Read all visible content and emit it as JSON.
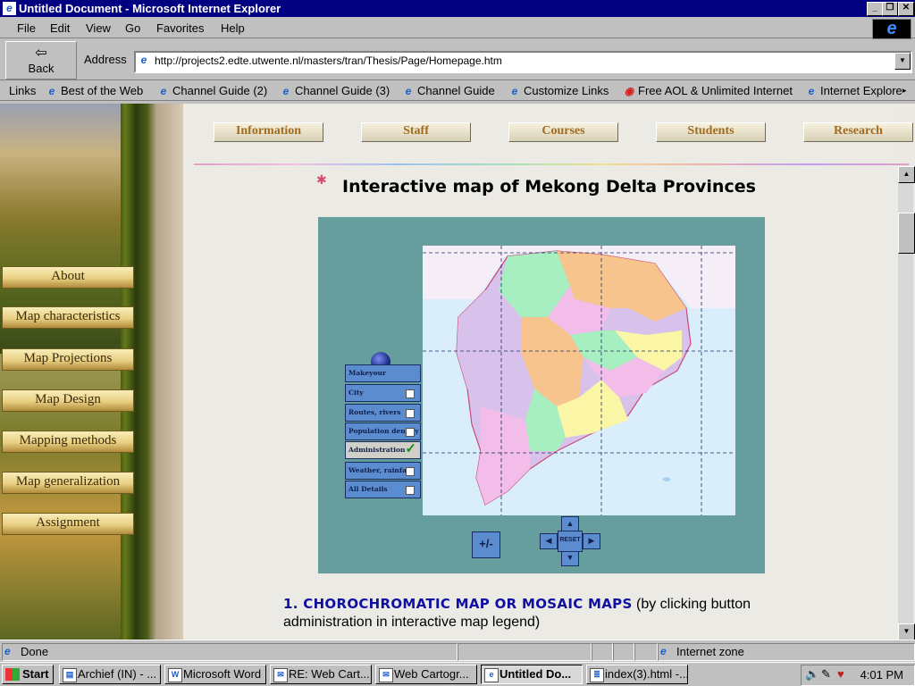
{
  "window": {
    "title": "Untitled Document - Microsoft Internet Explorer"
  },
  "menubar": {
    "items": [
      "File",
      "Edit",
      "View",
      "Go",
      "Favorites",
      "Help"
    ]
  },
  "toolbar": {
    "back_label": "Back"
  },
  "address": {
    "label": "Address",
    "url": "http://projects2.edte.utwente.nl/masters/tran/Thesis/Page/Homepage.htm"
  },
  "links": {
    "label": "Links",
    "items": [
      "Best of the Web",
      "Channel Guide (2)",
      "Channel Guide (3)",
      "Channel Guide",
      "Customize Links",
      "Free AOL & Unlimited Internet",
      "Internet Explore"
    ]
  },
  "sidebar": {
    "items": [
      "About",
      "Map characteristics",
      "Map Projections",
      "Map Design",
      "Mapping methods",
      "Map generalization",
      "Assignment"
    ]
  },
  "topnav": {
    "items": [
      "Information",
      "Staff",
      "Courses",
      "Students",
      "Research"
    ]
  },
  "page": {
    "title": "Interactive map of Mekong Delta Provinces",
    "section_heading": "1. CHOROCHROMATIC MAP OR MOSAIC MAPS",
    "section_text": " (by clicking button administration in interactive map legend)"
  },
  "map": {
    "legend": [
      {
        "label": "Makeyour choice....",
        "state": "none"
      },
      {
        "label": "City",
        "state": "unchecked"
      },
      {
        "label": "Routes, rivers",
        "state": "unchecked"
      },
      {
        "label": "Population density",
        "state": "unchecked"
      },
      {
        "label": "Administration",
        "state": "checked"
      },
      {
        "label": "Weather, rainfall",
        "state": "unchecked"
      },
      {
        "label": "All Details",
        "state": "unchecked"
      }
    ],
    "zoom_label": "+/-",
    "reset_label": "RESET"
  },
  "status": {
    "text": "Done",
    "zone": "Internet zone"
  },
  "taskbar": {
    "start": "Start",
    "tasks": [
      "Archief (IN) - ...",
      "Microsoft Word",
      "RE: Web Cart...",
      "Web Cartogr...",
      "Untitled Do...",
      "index(3).html -..."
    ],
    "clock": "4:01 PM"
  }
}
